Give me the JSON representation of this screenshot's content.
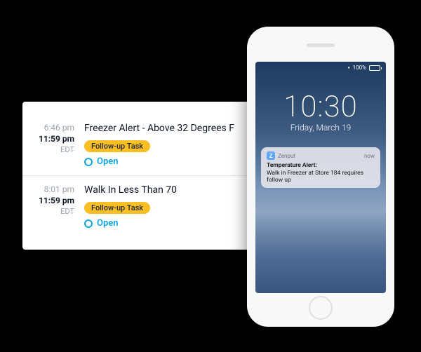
{
  "tasks": [
    {
      "time_primary": "6:46 pm",
      "time_secondary": "11:59 pm",
      "zone": "EDT",
      "title": "Freezer Alert - Above 32 Degrees F",
      "badge": "Follow-up Task",
      "status": "Open"
    },
    {
      "time_primary": "8:01 pm",
      "time_secondary": "11:59 pm",
      "zone": "EDT",
      "title": "Walk In Less Than 70",
      "badge": "Follow-up Task",
      "status": "Open"
    }
  ],
  "phone": {
    "battery_text": "100%",
    "lock_time": "10:30",
    "lock_date": "Friday, March 19",
    "notification": {
      "app_name": "Zenput",
      "app_letter": "Z",
      "when": "now",
      "title": "Temperature Alert:",
      "body": "Walk in Freezer at Store 184 requires follow up"
    }
  }
}
